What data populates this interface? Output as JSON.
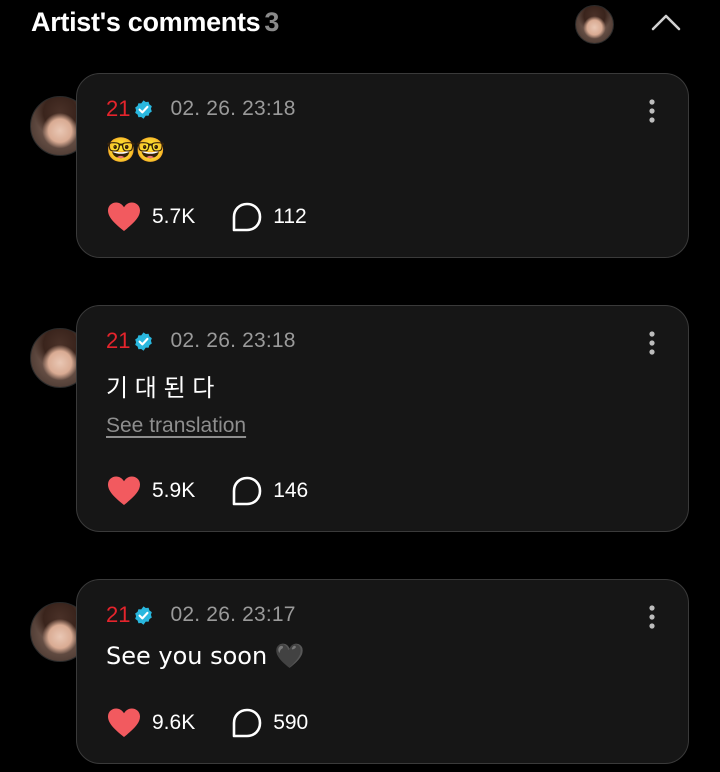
{
  "header": {
    "title": "Artist's comments",
    "count": "3"
  },
  "icons": {
    "verified": "verified-badge-icon",
    "like": "heart-icon",
    "reply": "comment-bubble-icon",
    "more": "more-vertical-icon",
    "collapse": "chevron-up-icon"
  },
  "colors": {
    "background": "#000000",
    "card": "#161616",
    "author": "#e5242c",
    "heart": "#f25a5f",
    "verified": "#29b7de"
  },
  "comments": [
    {
      "author": "21",
      "timestamp": "02. 26. 23:18",
      "text": "🤓🤓",
      "likes": "5.7K",
      "replies": "112"
    },
    {
      "author": "21",
      "timestamp": "02. 26. 23:18",
      "text": "기 대 된 다",
      "translation_label": "See translation",
      "likes": "5.9K",
      "replies": "146"
    },
    {
      "author": "21",
      "timestamp": "02. 26. 23:17",
      "text": "See you soon 🖤",
      "likes": "9.6K",
      "replies": "590"
    }
  ]
}
